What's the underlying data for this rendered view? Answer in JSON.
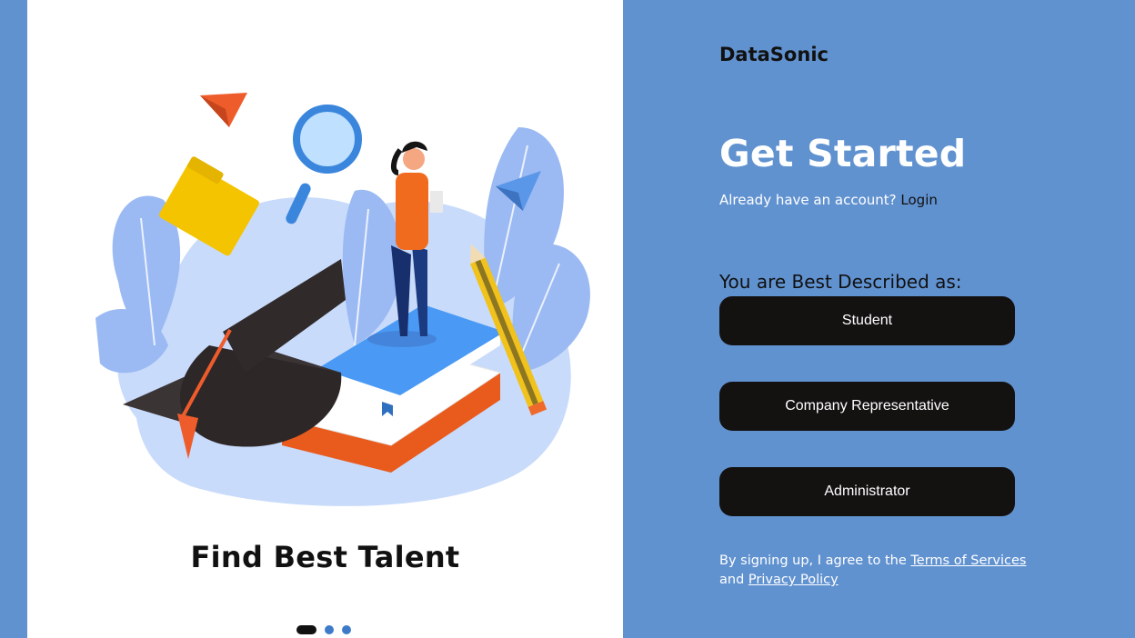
{
  "left": {
    "slide_title": "Find Best Talent",
    "carousel": {
      "count": 3,
      "active": 0
    }
  },
  "right": {
    "brand": "DataSonic",
    "heading": "Get Started",
    "account_prompt": "Already have an account?",
    "login_label": "Login",
    "describe_label": "You are Best Described as:",
    "roles": [
      "Student",
      "Company Representative",
      "Administrator"
    ],
    "terms_prefix": "By signing up, I agree to the",
    "terms_link": "Terms of Services",
    "terms_and": "and",
    "privacy_link": "Privacy Policy"
  },
  "colors": {
    "page_background": "#6192d0",
    "card_background": "#ffffff",
    "button_background": "#141111",
    "dot_inactive": "#3d7bc8",
    "dot_active": "#111111"
  }
}
